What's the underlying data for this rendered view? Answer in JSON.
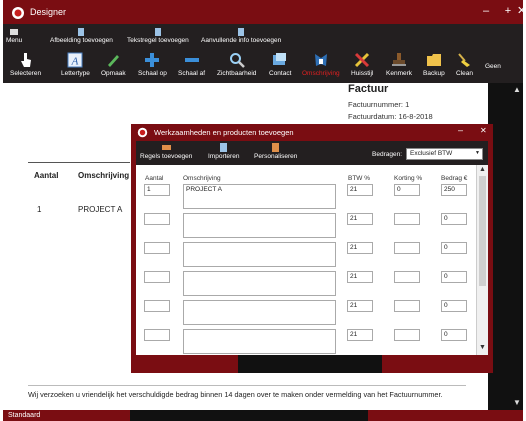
{
  "window": {
    "title": "Designer"
  },
  "toolbar1": [
    {
      "label": "Menu",
      "icon": "menu-icon"
    },
    {
      "label": "Afbeelding toevoegen",
      "icon": "image-icon"
    },
    {
      "label": "Tekstregel toevoegen",
      "icon": "text-line-icon"
    },
    {
      "label": "Aanvullende info toevoegen",
      "icon": "info-icon"
    }
  ],
  "toolbar2": [
    {
      "label": "Selecteren",
      "icon": "pointer-icon"
    },
    {
      "label": "Lettertype",
      "icon": "font-icon"
    },
    {
      "label": "Opmaak",
      "icon": "pen-icon"
    },
    {
      "label": "Schaal op",
      "icon": "plus-icon"
    },
    {
      "label": "Schaal af",
      "icon": "minus-icon"
    },
    {
      "label": "Zichtbaarheid",
      "icon": "magnifier-icon"
    },
    {
      "label": "Contact",
      "icon": "contact-icon"
    },
    {
      "label": "Omschrijving",
      "icon": "description-icon"
    },
    {
      "label": "Huisstijl",
      "icon": "tools-icon"
    },
    {
      "label": "Kenmerk",
      "icon": "stamp-icon"
    },
    {
      "label": "Backup",
      "icon": "folder-icon"
    },
    {
      "label": "Clean",
      "icon": "broom-icon"
    },
    {
      "label": "Geen",
      "icon": ""
    }
  ],
  "document": {
    "title": "Factuur",
    "factuurnummer": "Factuurnummer: 1",
    "factuurdatum": "Factuurdatum: 16-8-2018",
    "col_aantal": "Aantal",
    "col_omschrijving": "Omschrijving",
    "row_aantal": "1",
    "row_omschrijving": "PROJECT A",
    "footer": "Wij verzoeken u vriendelijk het verschuldigde bedrag binnen 14 dagen over te maken onder vermelding van het Factuurnummer."
  },
  "statusbar": {
    "label": "Standaard"
  },
  "dialog": {
    "title": "Werkzaamheden en producten toevoegen",
    "toolbar": [
      {
        "label": "Regels toevoegen",
        "icon": "add-rows-icon"
      },
      {
        "label": "Importeren",
        "icon": "import-icon"
      },
      {
        "label": "Personaliseren",
        "icon": "personalize-icon"
      }
    ],
    "bedragen_label": "Bedragen:",
    "bedragen_value": "Exclusief BTW",
    "columns": {
      "aantal": "Aantal",
      "omschrijving": "Omschrijving",
      "btw": "BTW %",
      "korting": "Korting %",
      "bedrag": "Bedrag €"
    },
    "rows": [
      {
        "aantal": "1",
        "omschrijving": "PROJECT A",
        "btw": "21",
        "korting": "0",
        "bedrag": "250"
      },
      {
        "aantal": "",
        "omschrijving": "",
        "btw": "21",
        "korting": "",
        "bedrag": "0"
      },
      {
        "aantal": "",
        "omschrijving": "",
        "btw": "21",
        "korting": "",
        "bedrag": "0"
      },
      {
        "aantal": "",
        "omschrijving": "",
        "btw": "21",
        "korting": "",
        "bedrag": "0"
      },
      {
        "aantal": "",
        "omschrijving": "",
        "btw": "21",
        "korting": "",
        "bedrag": "0"
      },
      {
        "aantal": "",
        "omschrijving": "",
        "btw": "21",
        "korting": "",
        "bedrag": "0"
      }
    ]
  },
  "colors": {
    "titlebar": "#7a0d12",
    "toolbar": "#231f20",
    "active": "#e02020"
  }
}
